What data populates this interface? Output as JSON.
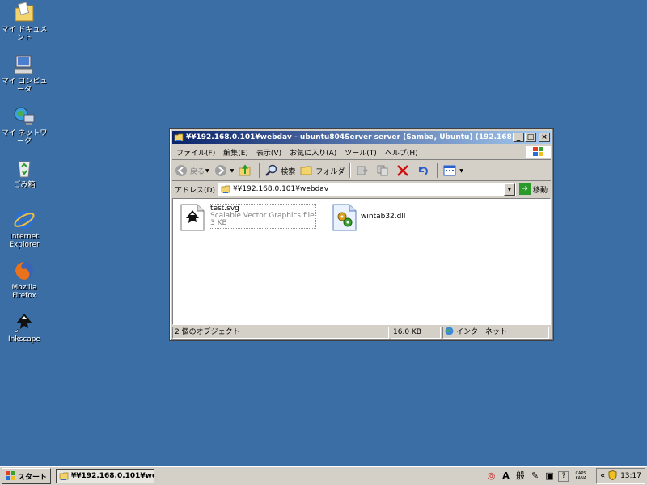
{
  "desktop": {
    "icons": [
      {
        "label": "マイ ドキュメント",
        "icon": "my-documents-icon"
      },
      {
        "label": "マイ コンピュータ",
        "icon": "my-computer-icon"
      },
      {
        "label": "マイ ネットワーク",
        "icon": "my-network-icon"
      },
      {
        "label": "ごみ箱",
        "icon": "recycle-bin-icon"
      },
      {
        "label_line1": "Internet",
        "label_line2": "Explorer",
        "icon": "internet-explorer-icon"
      },
      {
        "label_line1": "Mozilla",
        "label_line2": "Firefox",
        "icon": "firefox-icon"
      },
      {
        "label": "Inkscape",
        "icon": "inkscape-icon"
      }
    ]
  },
  "window": {
    "title": "¥¥192.168.0.101¥webdav - ubuntu804Server server (Samba, Ubuntu) (192.168.0.101)",
    "menu": [
      "ファイル(F)",
      "編集(E)",
      "表示(V)",
      "お気に入り(A)",
      "ツール(T)",
      "ヘルプ(H)"
    ],
    "toolbar": {
      "back": "戻る",
      "search": "検索",
      "folders": "フォルダ"
    },
    "address": {
      "label": "アドレス(D)",
      "value": "¥¥192.168.0.101¥webdav",
      "go": "移動"
    },
    "files": [
      {
        "name": "test.svg",
        "type": "Scalable Vector Graphics file",
        "size": "3 KB"
      },
      {
        "name": "wintab32.dll"
      }
    ],
    "status": {
      "objects": "2 個のオブジェクト",
      "size": "16.0 KB",
      "zone": "インターネット"
    }
  },
  "taskbar": {
    "start": "スタート",
    "task": "¥¥192.168.0.101¥web...",
    "ime": "般",
    "caps": "CAPS",
    "kana": "KANA",
    "clock": "13:17"
  },
  "colors": {
    "desktop": "#3a6ea5",
    "titlebar_start": "#0a246a",
    "titlebar_end": "#a6caf0",
    "face": "#d4d0c8"
  }
}
